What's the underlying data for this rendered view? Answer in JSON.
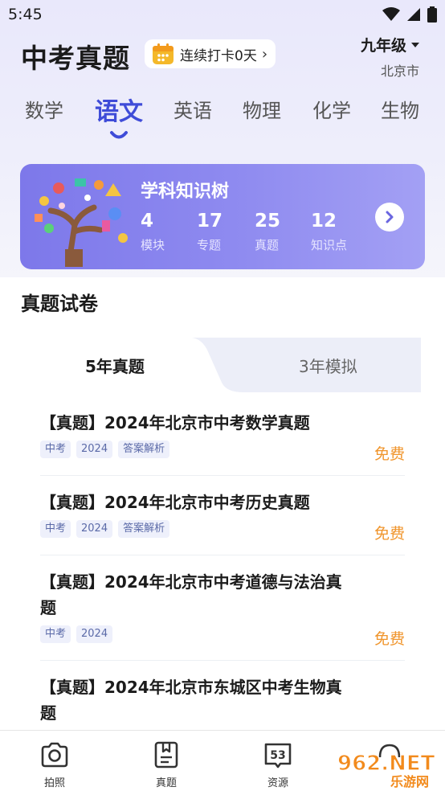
{
  "status_bar": {
    "time": "5:45"
  },
  "header": {
    "title": "中考真题",
    "checkin_label": "连续打卡0天",
    "grade": "九年级",
    "city": "北京市"
  },
  "subjects": [
    {
      "label": "数学",
      "active": false
    },
    {
      "label": "语文",
      "active": true
    },
    {
      "label": "英语",
      "active": false
    },
    {
      "label": "物理",
      "active": false
    },
    {
      "label": "化学",
      "active": false
    },
    {
      "label": "生物",
      "active": false
    }
  ],
  "knowledge_card": {
    "title": "学科知识树",
    "stats": [
      {
        "value": "4",
        "label": "模块"
      },
      {
        "value": "17",
        "label": "专题"
      },
      {
        "value": "25",
        "label": "真题"
      },
      {
        "value": "12",
        "label": "知识点"
      }
    ]
  },
  "section": {
    "title": "真题试卷"
  },
  "paper_tabs": {
    "active": "5年真题",
    "inactive": "3年模拟"
  },
  "papers": [
    {
      "title_line1": "【真题】2024年北京市中考数学真题",
      "title_line2": "",
      "tags": [
        "中考",
        "2024",
        "答案解析"
      ],
      "price": "免费"
    },
    {
      "title_line1": "【真题】2024年北京市中考历史真题",
      "title_line2": "",
      "tags": [
        "中考",
        "2024",
        "答案解析"
      ],
      "price": "免费"
    },
    {
      "title_line1": "【真题】2024年北京市中考道德与法治真",
      "title_line2": "题",
      "tags": [
        "中考",
        "2024"
      ],
      "price": "免费"
    },
    {
      "title_line1": "【真题】2024年北京市东城区中考生物真",
      "title_line2": "题",
      "tags": [],
      "price": ""
    }
  ],
  "bottom_nav": {
    "items": [
      {
        "label": "拍照",
        "icon": "camera-icon"
      },
      {
        "label": "真题",
        "icon": "document-icon"
      },
      {
        "label": "资源",
        "icon": "book-53-icon",
        "badge": "53"
      },
      {
        "label": "",
        "icon": "headset-icon"
      }
    ]
  },
  "watermark": {
    "text": "962.NET",
    "subtext": "乐游网"
  },
  "colors": {
    "accent": "#3f4cd8",
    "card": "#8a86ee",
    "price": "#f0952c",
    "tag_bg": "#eef0fb"
  }
}
